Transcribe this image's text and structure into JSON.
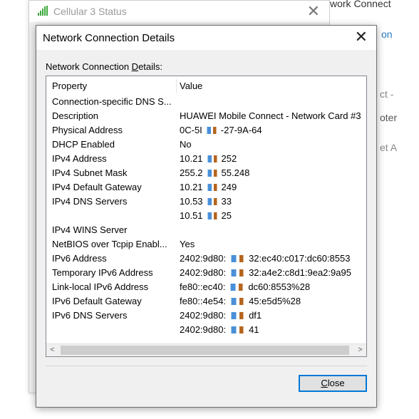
{
  "background_window": {
    "title": "Cellular 3 Status",
    "close_glyph": "✕",
    "icon": "signal-bars-icon"
  },
  "right_window": {
    "top_text": "work Connect",
    "tab_text": "on",
    "line1": "ct -",
    "line2": "oter",
    "line3": "et A"
  },
  "dialog": {
    "title": "Network Connection Details",
    "close_glyph": "✕",
    "caption_pre": "Network Connection ",
    "caption_underlined": "D",
    "caption_post": "etails:",
    "columns": {
      "property": "Property",
      "value": "Value"
    },
    "rows": [
      {
        "property": "Connection-specific DNS S...",
        "value": ""
      },
      {
        "property": "Description",
        "value": "HUAWEI Mobile Connect - Network Card #3"
      },
      {
        "property": "Physical Address",
        "value": "0C-5I",
        "value2": "-27-9A-64"
      },
      {
        "property": "DHCP Enabled",
        "value": "No"
      },
      {
        "property": "IPv4 Address",
        "value": "10.21",
        "value2": "252"
      },
      {
        "property": "IPv4 Subnet Mask",
        "value": "255.2",
        "value2": "55.248"
      },
      {
        "property": "IPv4 Default Gateway",
        "value": "10.21",
        "value2": "249"
      },
      {
        "property": "IPv4 DNS Servers",
        "value": "10.53",
        "value2": "33"
      },
      {
        "property": "",
        "value": "10.51",
        "value2": "25"
      },
      {
        "property": "IPv4 WINS Server",
        "value": ""
      },
      {
        "property": "NetBIOS over Tcpip Enabl...",
        "value": "Yes"
      },
      {
        "property": "IPv6 Address",
        "value": "2402:9d80:",
        "value2": "32:ec40:c017:dc60:8553"
      },
      {
        "property": "Temporary IPv6 Address",
        "value": "2402:9d80:",
        "value2": "32:a4e2:c8d1:9ea2:9a95"
      },
      {
        "property": "Link-local IPv6 Address",
        "value": "fe80::ec40:",
        "value2": "dc60:8553%28"
      },
      {
        "property": "IPv6 Default Gateway",
        "value": "fe80::4e54:",
        "value2": "45:e5d5%28"
      },
      {
        "property": "IPv6 DNS Servers",
        "value": "2402:9d80:",
        "value2": "df1"
      },
      {
        "property": "",
        "value": "2402:9d80:",
        "value2": "41"
      }
    ],
    "scroll_left": "<",
    "scroll_right": ">",
    "close_button": {
      "underlined": "C",
      "rest": "lose"
    }
  }
}
